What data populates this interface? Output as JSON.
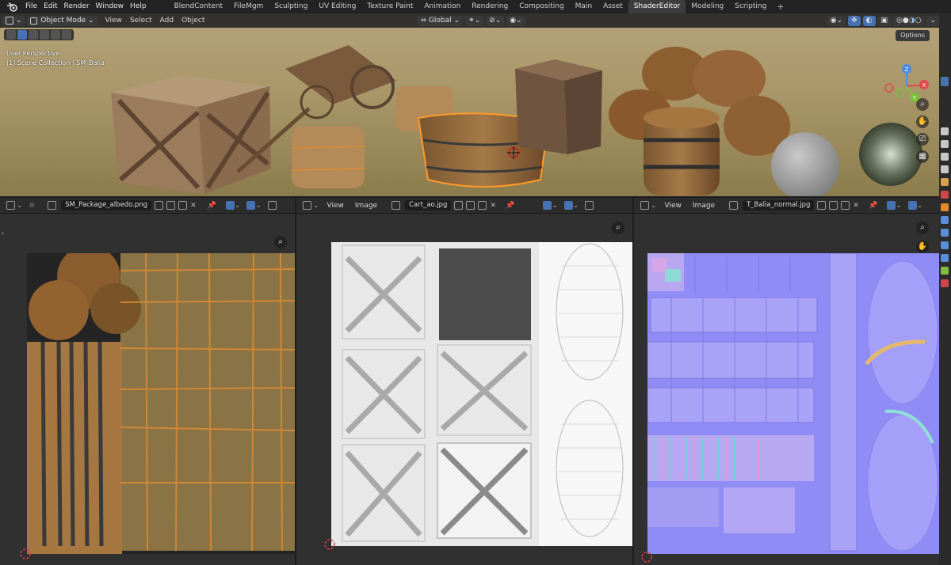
{
  "menu": {
    "items": [
      "File",
      "Edit",
      "Render",
      "Window",
      "Help"
    ],
    "workspaces": [
      "BlendContent",
      "FileMgm",
      "Sculpting",
      "UV Editing",
      "Texture Paint",
      "Animation",
      "Rendering",
      "Compositing",
      "Main",
      "Asset",
      "ShaderEditor",
      "Modeling",
      "Scripting"
    ],
    "active_workspace": "ShaderEditor",
    "add_tab": "+"
  },
  "viewport": {
    "mode": "Object Mode",
    "menus": [
      "View",
      "Select",
      "Add",
      "Object"
    ],
    "transform_orientation": "Global",
    "options": "Options",
    "overlay_line1": "User Perspective",
    "overlay_line2": "(1) Scene Collection | SM_Balia",
    "gizmo_x": "X",
    "gizmo_y": "Y",
    "gizmo_z": "Z"
  },
  "panels": [
    {
      "menus": [],
      "image_name": "SM_Package_albedo.png"
    },
    {
      "menus": [
        "View",
        "Image"
      ],
      "image_name": "Cart_ao.jpg"
    },
    {
      "menus": [
        "View",
        "Image"
      ],
      "image_name": "T_Balia_normal.jpg"
    }
  ],
  "icons": {
    "zoom": "magnifier-icon",
    "pan": "hand-icon",
    "pin": "pin-icon"
  }
}
